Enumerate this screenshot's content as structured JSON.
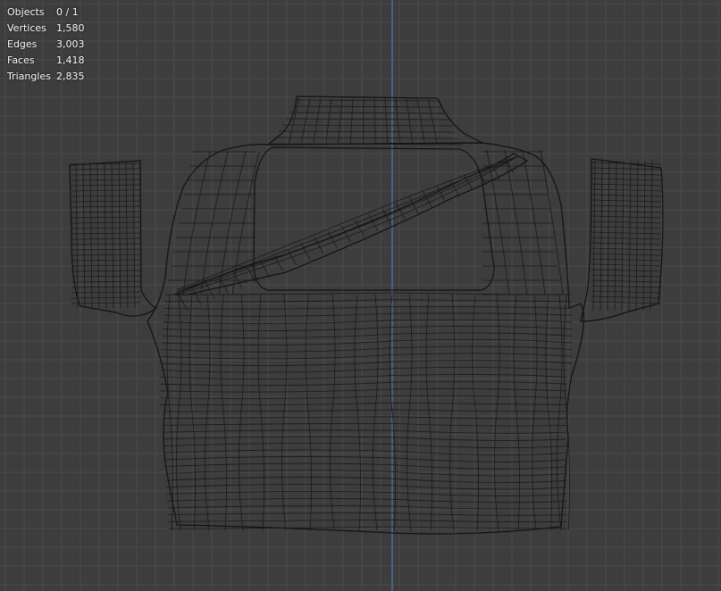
{
  "viewport": {
    "background_color": "#3d3d3d",
    "grid_color": "#4a4a4a",
    "axis_color": "#5a7fd6",
    "wire_color": "#111111"
  },
  "stats": {
    "objects": {
      "label": "Objects",
      "value": "0 / 1"
    },
    "vertices": {
      "label": "Vertices",
      "value": "1,580"
    },
    "edges": {
      "label": "Edges",
      "value": "3,003"
    },
    "faces": {
      "label": "Faces",
      "value": "1,418"
    },
    "triangles": {
      "label": "Triangles",
      "value": "2,835"
    }
  }
}
